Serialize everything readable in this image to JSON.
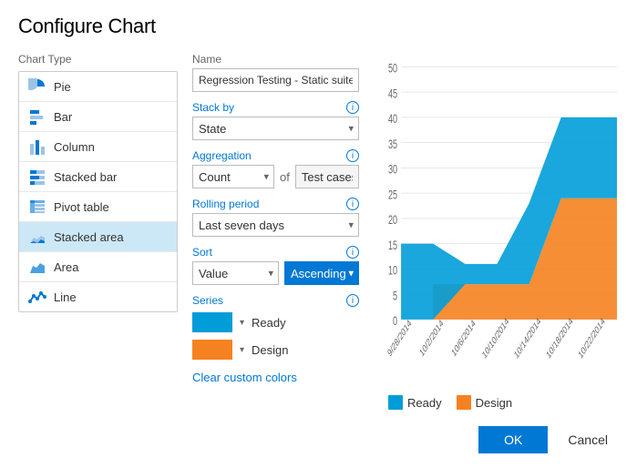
{
  "dialog": {
    "title": "Configure Chart"
  },
  "chartTypePanel": {
    "label": "Chart Type",
    "items": [
      {
        "id": "pie",
        "label": "Pie",
        "icon": "pie"
      },
      {
        "id": "bar",
        "label": "Bar",
        "icon": "bar"
      },
      {
        "id": "column",
        "label": "Column",
        "icon": "column"
      },
      {
        "id": "stacked-bar",
        "label": "Stacked bar",
        "icon": "stacked-bar"
      },
      {
        "id": "pivot-table",
        "label": "Pivot table",
        "icon": "pivot"
      },
      {
        "id": "stacked-area",
        "label": "Stacked area",
        "icon": "stacked-area",
        "active": true
      },
      {
        "id": "area",
        "label": "Area",
        "icon": "area"
      },
      {
        "id": "line",
        "label": "Line",
        "icon": "line"
      }
    ]
  },
  "configPanel": {
    "nameLabel": "Name",
    "nameValue": "Regression Testing - Static suite - Ch",
    "stackByLabel": "Stack by",
    "stackByValue": "State",
    "aggregationLabel": "Aggregation",
    "aggregationValue": "Count",
    "aggregationOf": "of",
    "aggregationField": "Test cases",
    "rollingPeriodLabel": "Rolling period",
    "rollingPeriodValue": "Last seven days",
    "sortLabel": "Sort",
    "sortField": "Value",
    "sortOrder": "Ascending",
    "seriesLabel": "Series",
    "series": [
      {
        "id": "ready",
        "label": "Ready",
        "color": "#009dd9"
      },
      {
        "id": "design",
        "label": "Design",
        "color": "#f58220"
      }
    ],
    "clearColorsLabel": "Clear custom colors"
  },
  "chart": {
    "yAxis": {
      "max": 50,
      "ticks": [
        0,
        5,
        10,
        15,
        20,
        25,
        30,
        35,
        40,
        45,
        50
      ]
    },
    "xAxis": {
      "labels": [
        "9/28/2014",
        "10/2/2014",
        "10/6/2014",
        "10/10/2014",
        "10/14/2014",
        "10/18/2014",
        "10/22/2014"
      ]
    },
    "legend": {
      "items": [
        {
          "label": "Ready",
          "color": "#009dd9"
        },
        {
          "label": "Design",
          "color": "#f58220"
        }
      ]
    }
  },
  "footer": {
    "okLabel": "OK",
    "cancelLabel": "Cancel"
  }
}
